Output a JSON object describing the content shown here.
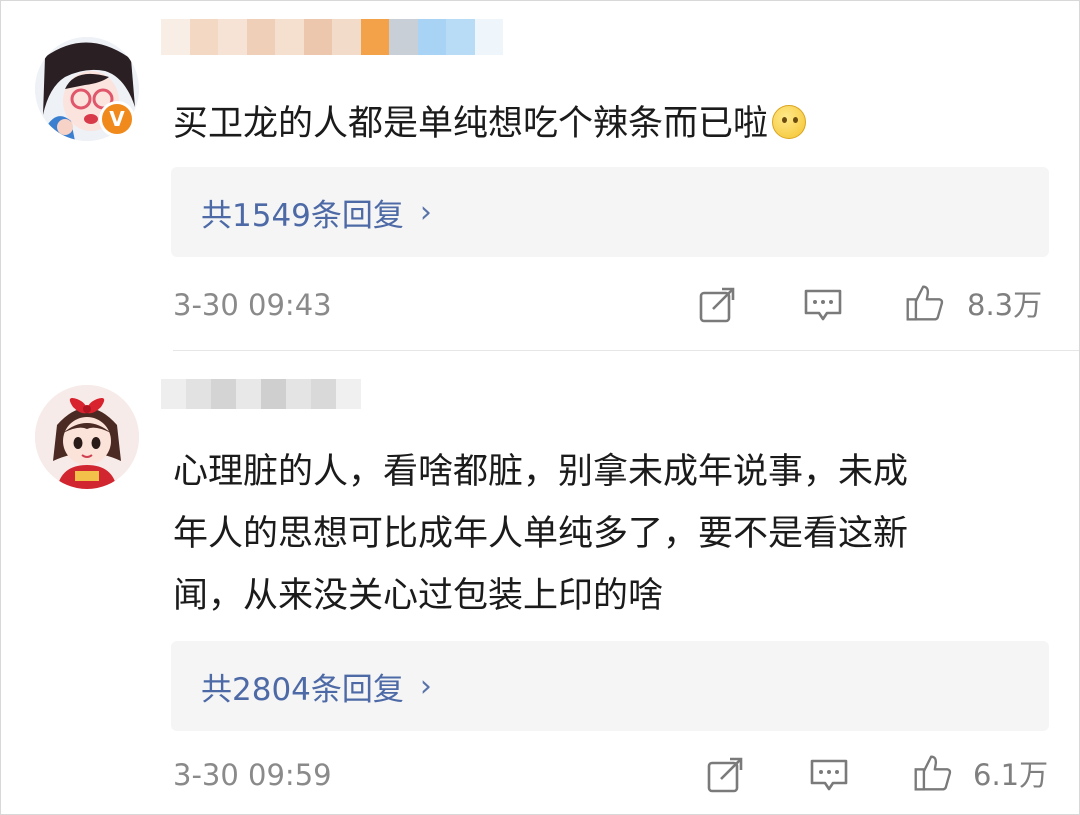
{
  "comments": [
    {
      "text": "买卫龙的人都是单纯想吃个辣条而已啦",
      "emoji": "thinking-face-emoji",
      "verified_badge": "V",
      "replies": "共1549条回复",
      "time": "3-30 09:43",
      "likes": "8.3万"
    },
    {
      "text_lines": [
        "心理脏的人，看啥都脏，别拿未成年说事，未成",
        "年人的思想可比成年人单纯多了，要不是看这新",
        "闻，从来没关心过包装上印的啥"
      ],
      "replies": "共2804条回复",
      "time": "3-30 09:59",
      "likes": "6.1万"
    }
  ],
  "icons": {
    "share": "share-icon",
    "comment": "comment-icon",
    "like": "thumbs-up-icon"
  },
  "colors": {
    "link": "#4d6aa6",
    "meta": "#8a8a8a",
    "reply_bg": "#f5f5f5",
    "badge": "#f08a1c"
  }
}
